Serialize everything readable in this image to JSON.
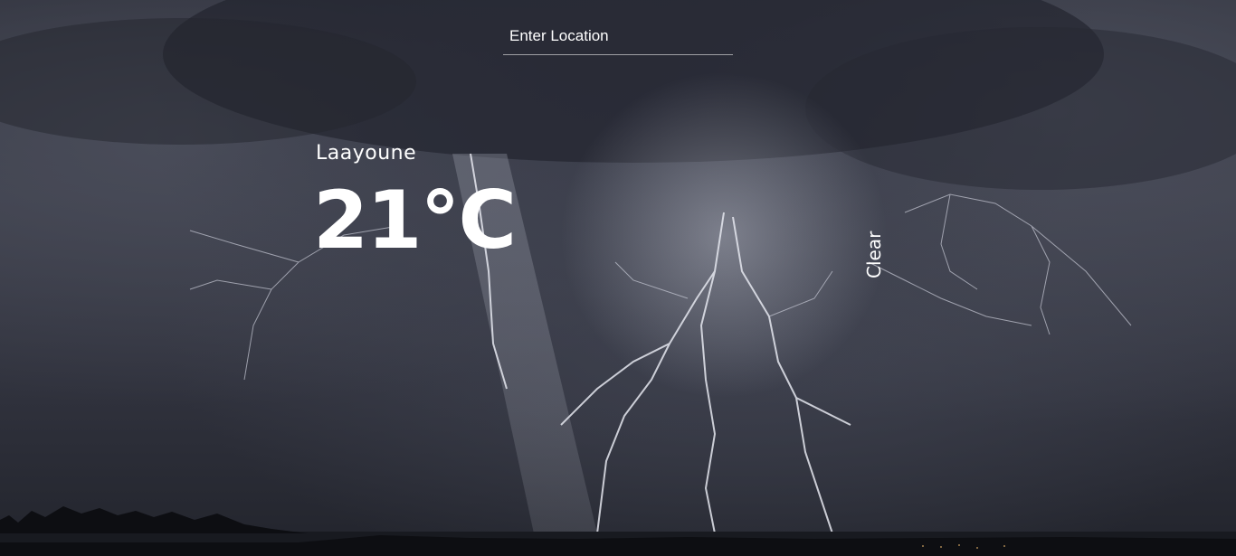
{
  "search": {
    "placeholder": "Enter Location",
    "value": ""
  },
  "weather": {
    "city": "Laayoune",
    "temperature": "21°C",
    "condition": "Clear"
  },
  "colors": {
    "text": "#ffffff",
    "sky_dark": "#2a2c36",
    "lightning": "#e6e8f0"
  }
}
